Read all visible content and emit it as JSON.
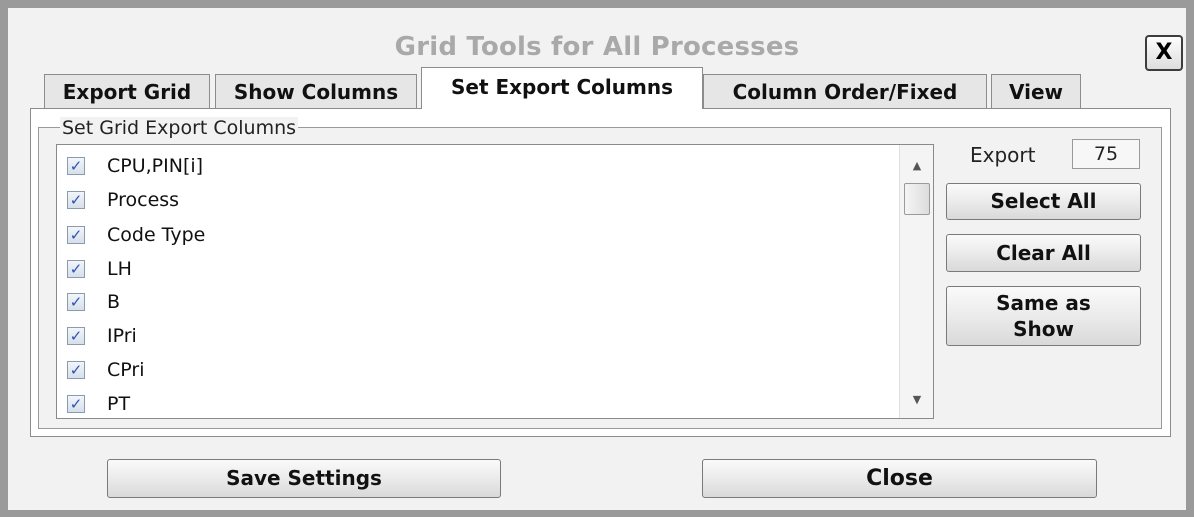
{
  "window": {
    "title": "Grid Tools for All Processes",
    "close_label": "X"
  },
  "tabs": [
    {
      "label": "Export Grid",
      "active": false
    },
    {
      "label": "Show Columns",
      "active": false
    },
    {
      "label": "Set Export Columns",
      "active": true
    },
    {
      "label": "Column Order/Fixed",
      "active": false
    },
    {
      "label": "View",
      "active": false
    }
  ],
  "export_columns": {
    "group_label": "Set Grid Export Columns",
    "items": [
      {
        "label": "CPU,PIN[i]",
        "checked": true
      },
      {
        "label": "Process",
        "checked": true
      },
      {
        "label": "Code Type",
        "checked": true
      },
      {
        "label": "LH",
        "checked": true
      },
      {
        "label": "B",
        "checked": true
      },
      {
        "label": "IPri",
        "checked": true
      },
      {
        "label": "CPri",
        "checked": true
      },
      {
        "label": "PT",
        "checked": true
      }
    ],
    "export_label": "Export",
    "export_count": "75",
    "select_all_label": "Select All",
    "clear_all_label": "Clear All",
    "same_as_show_line1": "Same as",
    "same_as_show_line2": "Show"
  },
  "footer": {
    "save_label": "Save Settings",
    "close_label": "Close"
  },
  "icons": {
    "checkmark": "check-icon",
    "scroll_up": "scroll-up-arrow-icon",
    "scroll_down": "scroll-down-arrow-icon"
  },
  "colors": {
    "title_text": "#a9a9a9",
    "checkmark": "#2a55b0",
    "window_bg": "#f2f2f2"
  }
}
